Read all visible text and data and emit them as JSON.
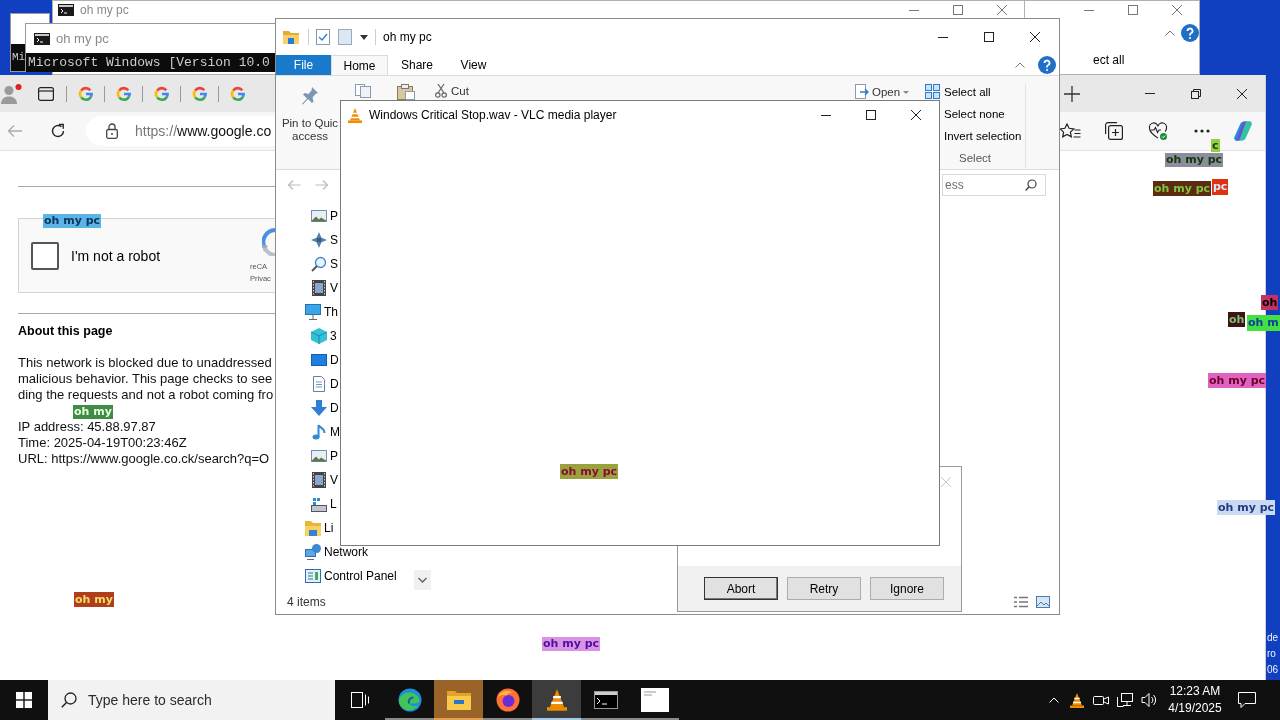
{
  "background_window": {
    "ribbon_text": "ect all"
  },
  "console_behind": {
    "title": "oh my pc"
  },
  "console_fragment": {
    "line": "Mi"
  },
  "console": {
    "title": "oh my pc",
    "line": "Microsoft Windows [Version 10.0"
  },
  "browser": {
    "tabs": [
      {
        "selected": false
      },
      {
        "selected": false
      },
      {
        "selected": false
      },
      {
        "selected": false
      },
      {
        "selected": false
      }
    ],
    "address": {
      "scheme": "https://",
      "rest": "www.google.co"
    },
    "page": {
      "checkbox": {
        "label": "I'm not a robot",
        "checked": false
      },
      "recaptcha": [
        "reCA",
        "Privac"
      ],
      "heading": "About this page",
      "lines": [
        "This network is blocked due to unaddressed",
        "malicious behavior. This page checks to see",
        "ding the requests and not a robot coming fro"
      ],
      "details": [
        "IP address: 45.88.97.87",
        "Time: 2025-04-19T00:23:46Z",
        "URL: https://www.google.co.ck/search?q=O"
      ]
    }
  },
  "explorer": {
    "title": "oh my pc",
    "tabs": [
      {
        "label": "File",
        "kind": "menu",
        "selected": false
      },
      {
        "label": "Home",
        "kind": "tab",
        "selected": true
      },
      {
        "label": "Share",
        "kind": "tab",
        "selected": false
      },
      {
        "label": "View",
        "kind": "tab",
        "selected": false
      }
    ],
    "ribbon": {
      "pin": [
        "Pin to Quic",
        "access"
      ],
      "cut": "Cut",
      "open": "Open",
      "select": [
        "Select all",
        "Select none",
        "Invert selection"
      ],
      "group": "Select"
    },
    "search": {
      "placeholder": "ess"
    },
    "nav": [
      {
        "children": [
          {
            "label": "P",
            "kind": "pictures"
          },
          {
            "label": "S",
            "kind": "tools"
          },
          {
            "label": "S",
            "kind": "search"
          },
          {
            "label": "V",
            "kind": "videos"
          }
        ]
      },
      {
        "label": "Th",
        "kind": "computer",
        "children": [
          {
            "label": "3",
            "kind": "objects"
          },
          {
            "label": "D",
            "kind": "desktop"
          },
          {
            "label": "D",
            "kind": "documents"
          },
          {
            "label": "D",
            "kind": "downloads"
          },
          {
            "label": "M",
            "kind": "music"
          },
          {
            "label": "P",
            "kind": "pictures"
          },
          {
            "label": "V",
            "kind": "videos"
          },
          {
            "label": "L",
            "kind": "drive"
          }
        ]
      },
      {
        "label": "Li",
        "kind": "libraries"
      },
      {
        "label": "Network",
        "kind": "network"
      },
      {
        "label": "Control Panel",
        "kind": "panel"
      }
    ],
    "status": "4 items"
  },
  "dialog": {
    "buttons": [
      {
        "label": "Abort",
        "default": true
      },
      {
        "label": "Retry",
        "default": false
      },
      {
        "label": "Ignore",
        "default": false
      }
    ]
  },
  "vlc": {
    "title": "Windows Critical Stop.wav - VLC media player"
  },
  "overlay_labels": [
    {
      "text": "oh my pc",
      "color": "#5ab4e6"
    },
    {
      "text": "oh my",
      "color": "#3f8c44"
    },
    {
      "text": "oh my",
      "color": "#b23c1e"
    },
    {
      "text": "oh my pc",
      "color": "#9aa23e"
    },
    {
      "text": "oh my pc",
      "color": "#dc92e4"
    },
    {
      "text": "c",
      "color": "#92d042"
    },
    {
      "text": "oh my pc",
      "color": "#8c8c9c"
    },
    {
      "text": "oh my pc",
      "color": "#5c2c10"
    },
    {
      "text": "pc",
      "color": "#e03212"
    },
    {
      "text": "oh",
      "color": "#c23262"
    },
    {
      "text": "oh",
      "color": "#42121a"
    },
    {
      "text": "oh m",
      "color": "#42e042"
    },
    {
      "text": "oh my pc",
      "color": "#e262c2"
    },
    {
      "text": "oh my pc",
      "color": "#cadaf2"
    }
  ],
  "desktop_text": [
    "de",
    "ro",
    "06"
  ],
  "taskbar": {
    "search": {
      "placeholder": "Type here to search"
    },
    "apps": [
      {
        "kind": "edge",
        "active": false,
        "attention": false
      },
      {
        "kind": "explorer",
        "active": false,
        "attention": true
      },
      {
        "kind": "firefox",
        "active": false,
        "attention": false
      },
      {
        "kind": "vlc",
        "active": true,
        "attention": false
      },
      {
        "kind": "console",
        "active": false,
        "attention": false
      },
      {
        "kind": "document",
        "active": false,
        "attention": false
      }
    ],
    "clock": {
      "time": "12:23 AM",
      "date": "4/19/2025"
    }
  }
}
